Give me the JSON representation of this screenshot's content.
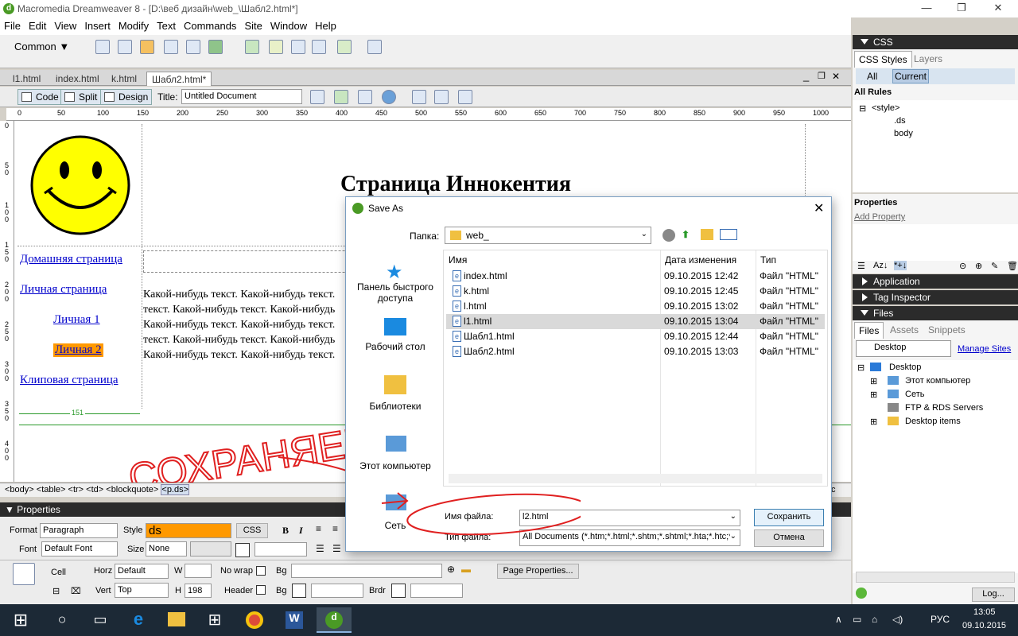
{
  "window": {
    "title": "Macromedia Dreamweaver 8 - [D:\\веб дизайн\\web_\\Шабл2.html*]",
    "minimize": "—",
    "restore": "❐",
    "close": "✕"
  },
  "menu": [
    "File",
    "Edit",
    "View",
    "Insert",
    "Modify",
    "Text",
    "Commands",
    "Site",
    "Window",
    "Help"
  ],
  "insert_bar": {
    "category": "Common"
  },
  "doc_tabs": [
    "l1.html",
    "index.html",
    "k.html",
    "Шабл2.html*"
  ],
  "doc_toolbar": {
    "code": "Code",
    "split": "Split",
    "design": "Design",
    "title_label": "Title:",
    "title_value": "Untitled Document"
  },
  "ruler_h": [
    "0",
    "50",
    "100",
    "150",
    "200",
    "250",
    "300",
    "350",
    "400",
    "450",
    "500",
    "550",
    "600",
    "650",
    "700",
    "750",
    "800",
    "850",
    "900",
    "950",
    "1000"
  ],
  "ruler_v": [
    "0",
    "5 0",
    "1 0 0",
    "1 5 0",
    "2 0 0",
    "2 5 0",
    "3 0 0",
    "3 5 0",
    "4 0 0"
  ],
  "page": {
    "heading": "Страница Иннокентия",
    "nav": {
      "home": "Домашняя страница",
      "personal": "Личная страница",
      "personal1": "Личная 1",
      "personal2": "Личная 2",
      "clip": "Клиповая страница"
    },
    "paragraph_lines": [
      "Какой-нибудь текст. Какой-нибудь текст.",
      "текст. Какой-нибудь текст. Какой-нибудь",
      "Какой-нибудь текст. Какой-нибудь текст.",
      "текст. Какой-нибудь текст. Какой-нибудь",
      "Какой-нибудь текст. Какой-нибудь текст."
    ],
    "column_width": "151",
    "annotation": "СОХРАНЯЕМ"
  },
  "tag_selector": [
    "<body>",
    "<table>",
    "<tr>",
    "<td>",
    "<blockquote>",
    "<p.ds>"
  ],
  "tag_selector_tail": "c",
  "properties": {
    "header": "Properties",
    "format_label": "Format",
    "format_value": "Paragraph",
    "style_label": "Style",
    "style_value": "ds",
    "css_button": "CSS",
    "font_label": "Font",
    "font_value": "Default Font",
    "size_label": "Size",
    "size_value": "None",
    "cell_label": "Cell",
    "horz_label": "Horz",
    "horz_value": "Default",
    "w_label": "W",
    "w_value": "",
    "nowrap_label": "No wrap",
    "bg_label": "Bg",
    "page_properties": "Page Properties...",
    "vert_label": "Vert",
    "vert_value": "Top",
    "h_label": "H",
    "h_value": "198",
    "header_label": "Header",
    "bg2_label": "Bg",
    "brdr_label": "Brdr"
  },
  "right_panels": {
    "css_header": "CSS",
    "css_tab": "CSS Styles",
    "layers_tab": "Layers",
    "all_button": "All",
    "current_button": "Current",
    "all_rules": "All Rules",
    "rules": [
      "<style>",
      ".ds",
      "body"
    ],
    "properties_header": "Properties",
    "add_property": "Add Property",
    "application": "Application",
    "tag_inspector": "Tag Inspector",
    "files": "Files",
    "files_tab": "Files",
    "assets_tab": "Assets",
    "snippets_tab": "Snippets",
    "site_select": "Desktop",
    "manage_sites": "Manage Sites",
    "tree": [
      "Desktop",
      "Этот компьютер",
      "Сеть",
      "FTP & RDS Servers",
      "Desktop items"
    ],
    "log_button": "Log..."
  },
  "dialog": {
    "title": "Save As",
    "folder_label": "Папка:",
    "folder_value": "web_",
    "places": [
      "Панель быстрого доступа",
      "Рабочий стол",
      "Библиотеки",
      "Этот компьютер",
      "Сеть"
    ],
    "columns": {
      "name": "Имя",
      "date": "Дата изменения",
      "type": "Тип"
    },
    "files": [
      {
        "name": "index.html",
        "date": "09.10.2015 12:42",
        "type": "Файл \"HTML\""
      },
      {
        "name": "k.html",
        "date": "09.10.2015 12:45",
        "type": "Файл \"HTML\""
      },
      {
        "name": "l.html",
        "date": "09.10.2015 13:02",
        "type": "Файл \"HTML\""
      },
      {
        "name": "l1.html",
        "date": "09.10.2015 13:04",
        "type": "Файл \"HTML\""
      },
      {
        "name": "Шабл1.html",
        "date": "09.10.2015 12:44",
        "type": "Файл \"HTML\""
      },
      {
        "name": "Шабл2.html",
        "date": "09.10.2015 13:03",
        "type": "Файл \"HTML\""
      }
    ],
    "filename_label": "Имя файла:",
    "filename_value": "l2.html",
    "filetype_label": "Тип файла:",
    "filetype_value": "All Documents (*.htm;*.html;*.shtm;*.shtml;*.hta;*.htc;*.",
    "save": "Сохранить",
    "cancel": "Отмена"
  },
  "taskbar": {
    "lang": "РУС",
    "time": "13:05",
    "date": "09.10.2015"
  },
  "colors": {
    "accent_orange": "#ff9900",
    "link_blue": "#0000cc",
    "smiley_yellow": "#ffff00",
    "annotation_red": "#e02020",
    "panel_dark": "#2b2b2b",
    "taskbar": "#1c2936"
  }
}
